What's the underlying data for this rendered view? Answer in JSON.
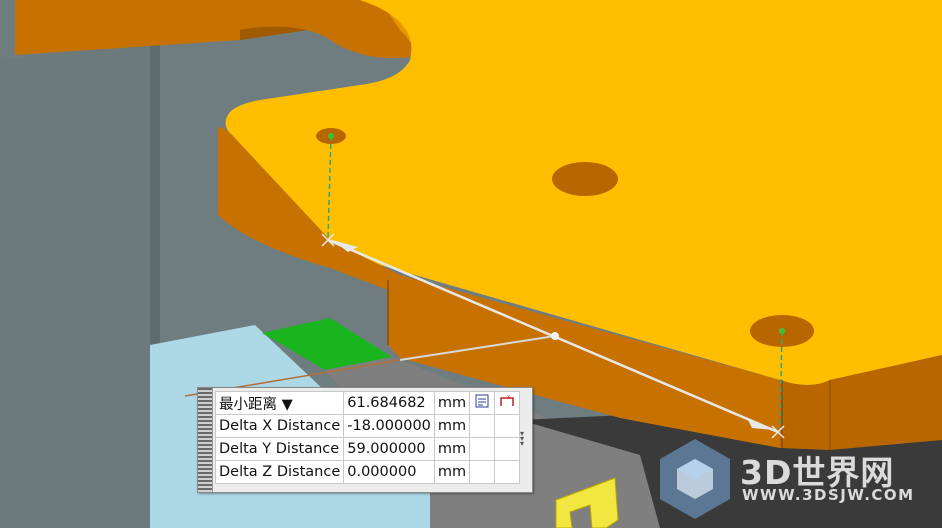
{
  "panel": {
    "rows": [
      {
        "label": "最小距离 ▼",
        "value": "61.684682",
        "unit": "mm"
      },
      {
        "label": "Delta X Distance",
        "value": "-18.000000",
        "unit": "mm"
      },
      {
        "label": "Delta Y Distance",
        "value": "59.000000",
        "unit": "mm"
      },
      {
        "label": "Delta Z Distance",
        "value": "0.000000",
        "unit": "mm"
      }
    ],
    "icons": [
      "measure-report-icon",
      "measure-xyz-icon",
      "expand-arrows-icon"
    ]
  },
  "watermark": {
    "text": "3D世界网",
    "url": "WWW.3DSJW.COM"
  },
  "colors": {
    "plate_top": "#ffbf00",
    "plate_side": "#c77200",
    "background": "#6f7d80",
    "measure_line": "#e8e8e8",
    "green_block": "#19b41e"
  }
}
